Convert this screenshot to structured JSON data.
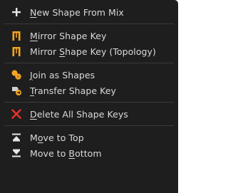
{
  "menu": {
    "items": [
      {
        "pre": "",
        "key": "N",
        "post": "ew Shape From Mix",
        "icon": "plus-icon"
      },
      {
        "pre": "",
        "key": "M",
        "post": "irror Shape Key",
        "icon": "mirror-icon"
      },
      {
        "pre": "Mirror ",
        "key": "S",
        "post": "hape Key (Topology)",
        "icon": "mirror-icon"
      },
      {
        "pre": "",
        "key": "J",
        "post": "oin as Shapes",
        "icon": "join-shapes-icon"
      },
      {
        "pre": "",
        "key": "T",
        "post": "ransfer Shape Key",
        "icon": "transfer-shape-icon"
      },
      {
        "pre": "",
        "key": "D",
        "post": "elete All Shape Keys",
        "icon": "x-icon"
      },
      {
        "pre": "M",
        "key": "o",
        "post": "ve to Top",
        "icon": "move-to-top-icon"
      },
      {
        "pre": "Move to ",
        "key": "B",
        "post": "ottom",
        "icon": "move-to-bottom-icon"
      }
    ]
  },
  "colors": {
    "background": "#1e1e1e",
    "text": "#d9d9d9",
    "icon_white": "#e6e6e6",
    "icon_orange": "#f5a623",
    "icon_red": "#e8332b"
  }
}
